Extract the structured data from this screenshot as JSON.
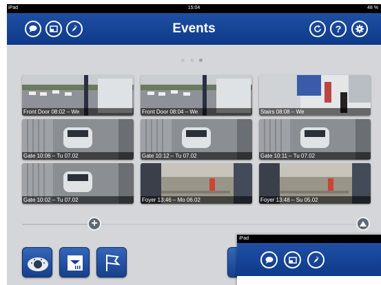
{
  "status_bar": {
    "device": "iPad",
    "time": "15:04",
    "battery": "48 %"
  },
  "navbar": {
    "title": "Events",
    "left_icons": [
      "chat-icon",
      "window-icon",
      "compass-icon"
    ],
    "right_icons": [
      "refresh-icon",
      "help-icon",
      "settings-icon"
    ]
  },
  "pager": {
    "pages": 3,
    "current": 3
  },
  "events": [
    {
      "label": "Front Door 08:02 – We",
      "scene": "parking"
    },
    {
      "label": "Front Door 08:04 – We",
      "scene": "parking"
    },
    {
      "label": "Stairs 08:08 – We",
      "scene": "stairs"
    },
    {
      "label": "Gate 10:06 – Tu 07.02",
      "scene": "gate"
    },
    {
      "label": "Gate 10:12 – Tu 07.02",
      "scene": "gate"
    },
    {
      "label": "Gate 10:11 – Tu 07.02",
      "scene": "gate"
    },
    {
      "label": "Gate 10:02 – Tu 07.02",
      "scene": "gate"
    },
    {
      "label": "Foyer 13:46 – Mo 06.02",
      "scene": "foyer"
    },
    {
      "label": "Foyer 13:48 – Su 05.02",
      "scene": "foyer"
    }
  ],
  "timeline": {
    "position": 0.2
  },
  "toolbar": {
    "buttons": [
      "camera-dome-icon",
      "event-list-icon",
      "flag-icon"
    ]
  },
  "popup": {
    "status": "iPad",
    "icons": [
      "chat-icon",
      "window-icon",
      "compass-icon"
    ]
  },
  "colors": {
    "nav_blue": "#1a4a9c",
    "background": "#d4d6d9"
  }
}
